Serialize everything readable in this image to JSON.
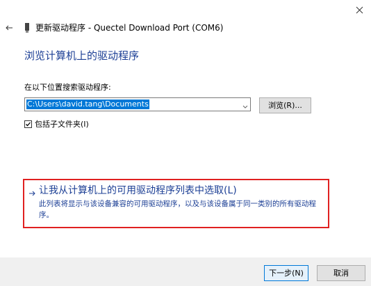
{
  "window": {
    "title": "更新驱动程序 - Quectel Download Port (COM6)"
  },
  "page": {
    "title": "浏览计算机上的驱动程序"
  },
  "search": {
    "label": "在以下位置搜索驱动程序:",
    "path_value": "C:\\Users\\david.tang\\Documents",
    "browse_label": "浏览(R)...",
    "include_subfolders_label": "包括子文件夹(I)",
    "include_subfolders_checked": true
  },
  "pick_option": {
    "title": "让我从计算机上的可用驱动程序列表中选取(L)",
    "description": "此列表将显示与该设备兼容的可用驱动程序，以及与该设备属于同一类别的所有驱动程序。",
    "highlight_color": "#e02020",
    "text_color": "#1c3f95"
  },
  "footer": {
    "next_label": "下一步(N)",
    "cancel_label": "取消"
  },
  "icons": {
    "close": "close-icon",
    "back": "back-arrow-icon",
    "device": "device-icon",
    "dropdown": "chevron-down-icon",
    "check": "checkmark-icon",
    "link_arrow": "arrow-right-icon"
  }
}
